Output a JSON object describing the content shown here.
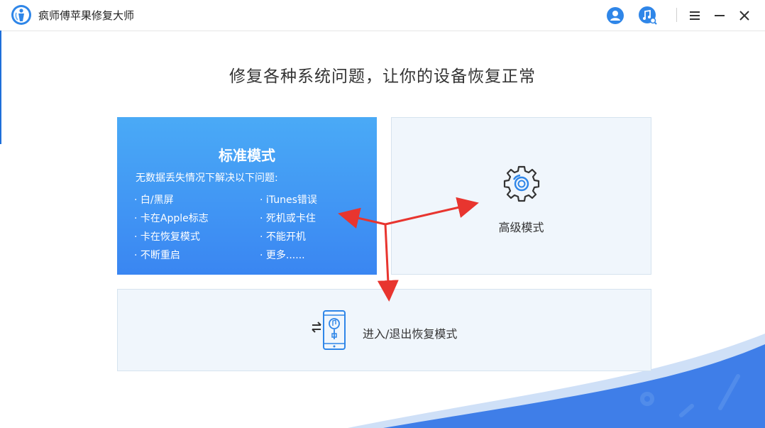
{
  "app": {
    "title": "疯师傅苹果修复大师"
  },
  "window_controls": [
    "user-icon",
    "music-search-icon",
    "menu-icon",
    "minimize-icon",
    "close-icon"
  ],
  "headline": "修复各种系统问题，让你的设备恢复正常",
  "standard_mode": {
    "title": "标准模式",
    "subtitle": "无数据丢失情况下解决以下问题:",
    "items_left": [
      "· 白/黑屏",
      "· 卡在Apple标志",
      "· 卡在恢复模式",
      "· 不断重启"
    ],
    "items_right": [
      "· iTunes错误",
      "· 死机或卡住",
      "· 不能开机",
      "· 更多......"
    ]
  },
  "advanced_mode": {
    "label": "高级模式",
    "icon": "gear-icon"
  },
  "recovery_mode": {
    "label": "进入/退出恢复模式",
    "icon": "phone-recovery-icon"
  },
  "colors": {
    "accent": "#3a86f2",
    "accent_light": "#4aaaf6",
    "card_bg": "#f0f6fc",
    "arrow": "#e8352f"
  }
}
